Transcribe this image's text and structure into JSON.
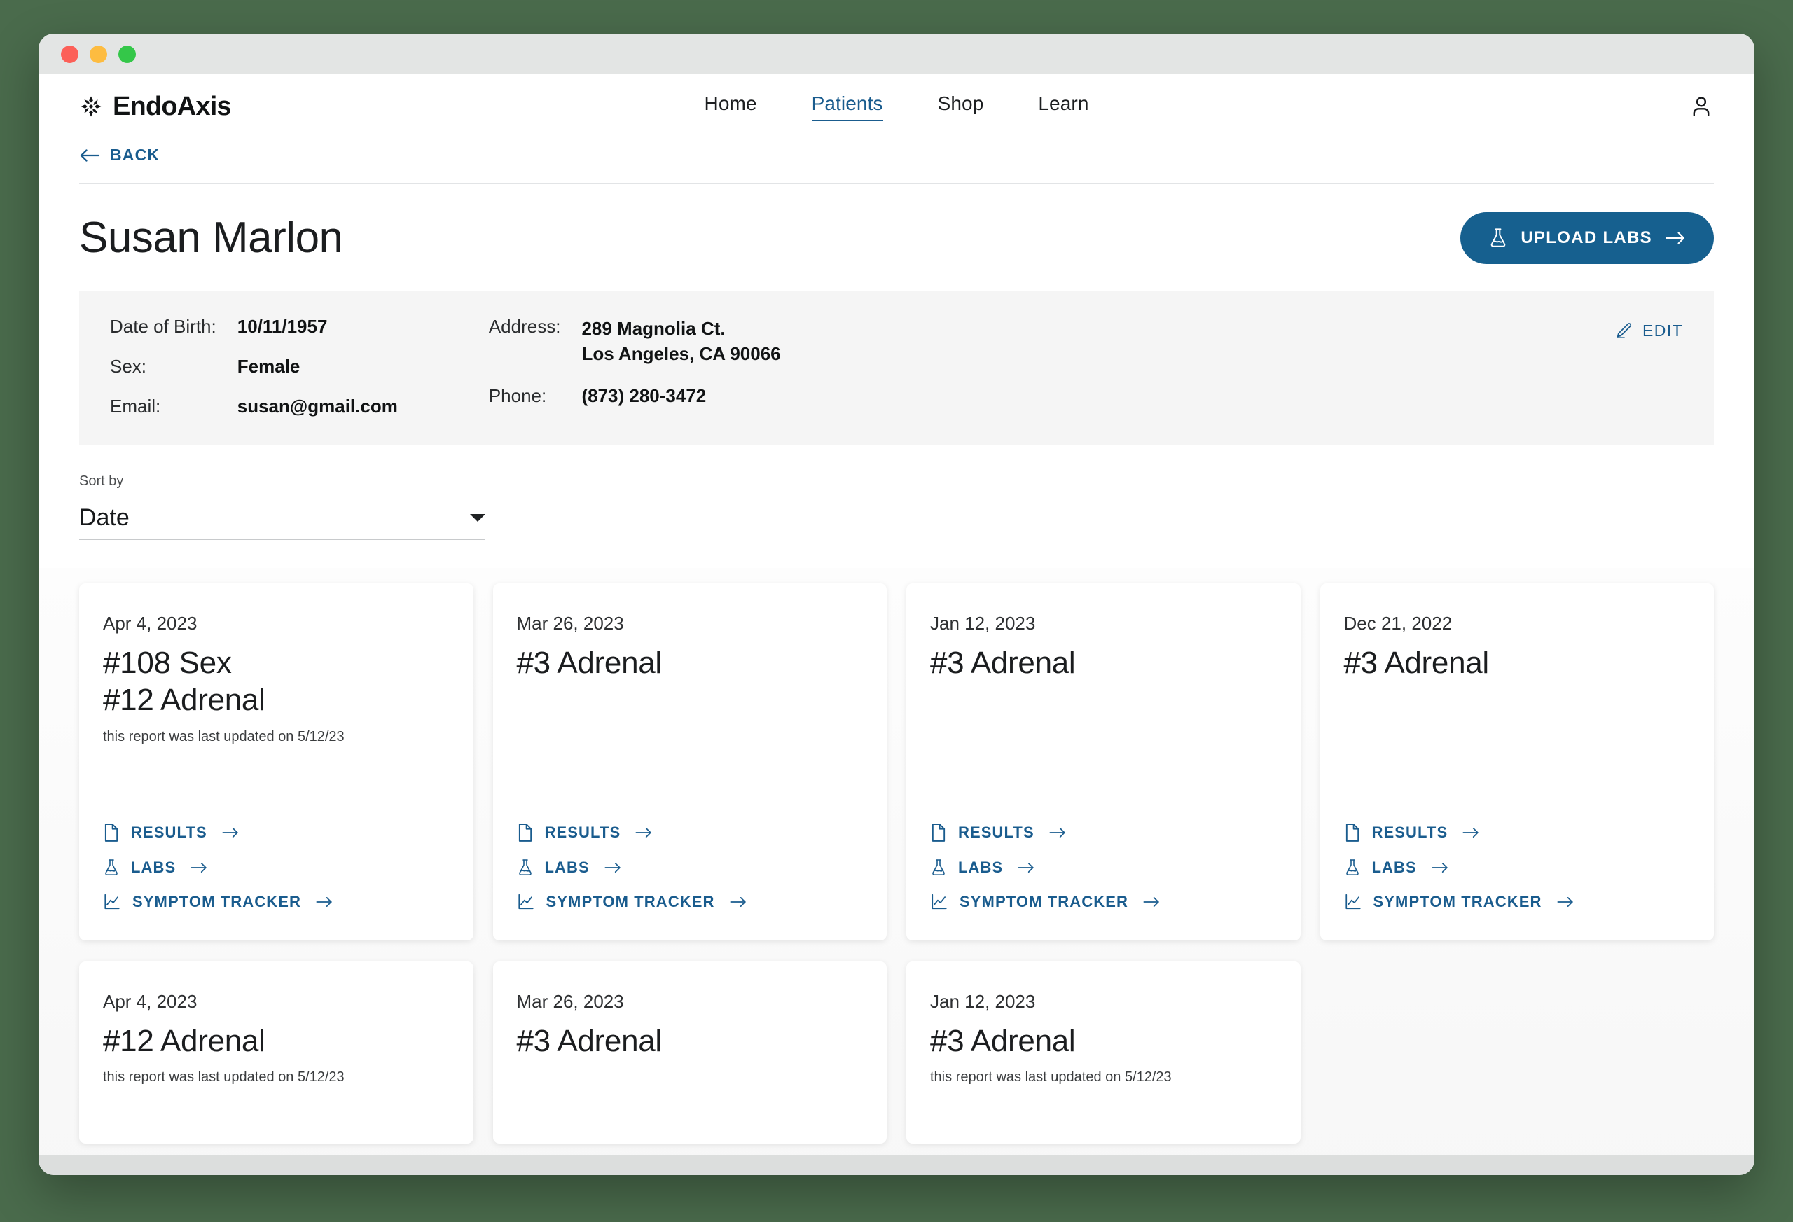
{
  "window": {
    "traffic_lights": [
      "close",
      "minimize",
      "zoom"
    ]
  },
  "header": {
    "brand_name": "EndoAxis",
    "brand_icon": "starburst-logo-icon",
    "account_icon": "person-icon",
    "nav": [
      {
        "label": "Home",
        "active": false
      },
      {
        "label": "Patients",
        "active": true
      },
      {
        "label": "Shop",
        "active": false
      },
      {
        "label": "Learn",
        "active": false
      }
    ]
  },
  "back": {
    "label": "BACK",
    "icon": "arrow-left-icon"
  },
  "patient": {
    "name": "Susan Marlon",
    "upload_button": {
      "label": "UPLOAD LABS",
      "icon": "flask-icon",
      "arrow": "arrow-right-icon",
      "color": "#16608f"
    },
    "edit_link": {
      "label": "EDIT",
      "icon": "pencil-icon"
    },
    "fields_left": [
      {
        "label": "Date of Birth:",
        "value": "10/11/1957"
      },
      {
        "label": "Sex:",
        "value": "Female"
      },
      {
        "label": "Email:",
        "value": "susan@gmail.com"
      }
    ],
    "fields_right": [
      {
        "label": "Address:",
        "value": "289 Magnolia Ct.\nLos Angeles, CA 90066"
      },
      {
        "label": "Phone:",
        "value": "(873) 280-3472"
      }
    ]
  },
  "sort": {
    "label": "Sort by",
    "value": "Date",
    "options": [
      "Date"
    ]
  },
  "card_links": [
    {
      "key": "results",
      "label": "RESULTS",
      "icon": "document-icon"
    },
    {
      "key": "labs",
      "label": "LABS",
      "icon": "flask-icon"
    },
    {
      "key": "symptom_tracker",
      "label": "SYMPTOM TRACKER",
      "icon": "line-chart-icon"
    }
  ],
  "reports": [
    {
      "date": "Apr 4, 2023",
      "title": "#108 Sex\n#12 Adrenal",
      "subtitle": "this report was last updated on 5/12/23"
    },
    {
      "date": "Mar 26, 2023",
      "title": "#3 Adrenal",
      "subtitle": ""
    },
    {
      "date": "Jan 12, 2023",
      "title": "#3 Adrenal",
      "subtitle": ""
    },
    {
      "date": "Dec 21, 2022",
      "title": "#3 Adrenal",
      "subtitle": ""
    },
    {
      "date": "Apr 4, 2023",
      "title": "#12 Adrenal",
      "subtitle": "this report was last updated on 5/12/23"
    },
    {
      "date": "Mar 26, 2023",
      "title": "#3 Adrenal",
      "subtitle": ""
    },
    {
      "date": "Jan 12, 2023",
      "title": "#3 Adrenal",
      "subtitle": "this report was last updated on 5/12/23"
    }
  ],
  "theme": {
    "accent_blue": "#1a5c8e",
    "page_background": "#4a6b4c",
    "panel_gray": "#f5f5f5"
  }
}
